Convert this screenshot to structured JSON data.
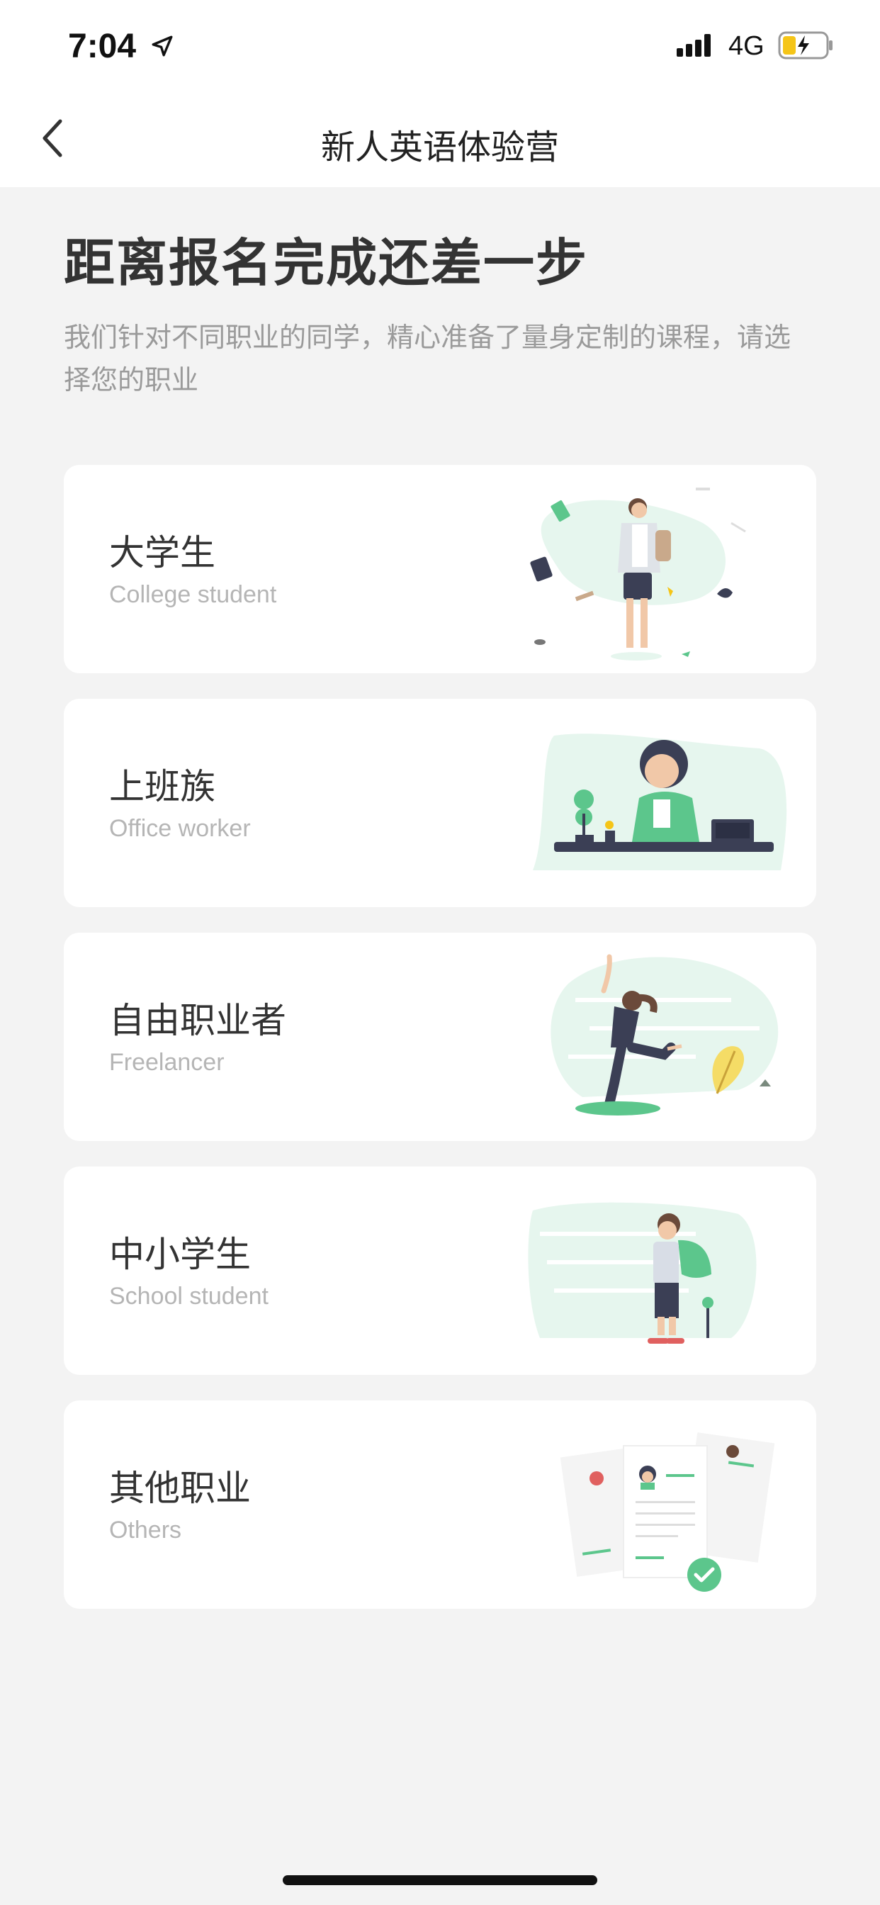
{
  "status_bar": {
    "time": "7:04",
    "network": "4G",
    "icons": [
      "location-arrow-icon",
      "signal-icon",
      "battery-charging-icon"
    ]
  },
  "nav": {
    "title": "新人英语体验营",
    "back_icon": "chevron-left-icon"
  },
  "main": {
    "heading": "距离报名完成还差一步",
    "subtext": "我们针对不同职业的同学，精心准备了量身定制的课程，请选择您的职业"
  },
  "colors": {
    "accent": "#5cc68c",
    "accent_light": "#e6f6ee",
    "background": "#f3f3f3"
  },
  "occupations": [
    {
      "title": "大学生",
      "subtitle": "College student",
      "icon": "college-student-illustration"
    },
    {
      "title": "上班族",
      "subtitle": "Office worker",
      "icon": "office-worker-illustration"
    },
    {
      "title": "自由职业者",
      "subtitle": "Freelancer",
      "icon": "freelancer-illustration"
    },
    {
      "title": "中小学生",
      "subtitle": "School student",
      "icon": "school-student-illustration"
    },
    {
      "title": "其他职业",
      "subtitle": "Others",
      "icon": "documents-illustration"
    }
  ]
}
